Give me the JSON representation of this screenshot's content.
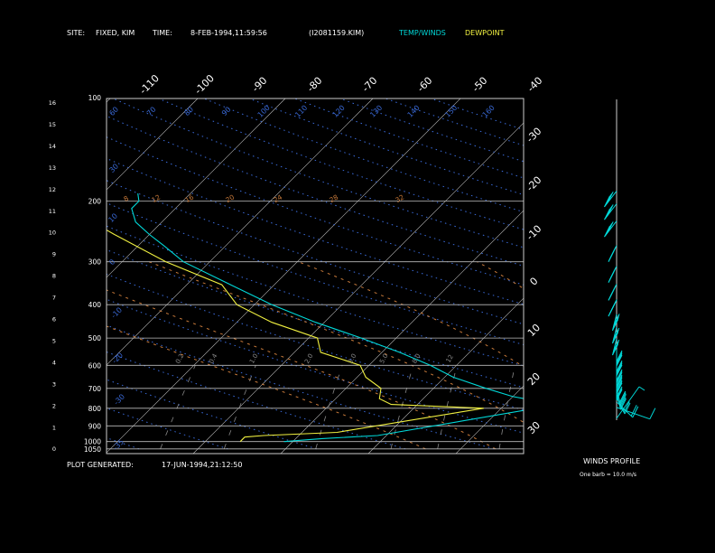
{
  "header": {
    "site_label": "SITE:",
    "site_value": "FIXED, KIM",
    "time_label": "TIME:",
    "time_value": "8-FEB-1994,11:59:56",
    "file_id": "(I2081159.KIM)",
    "legend_temp": "TEMP/WINDS",
    "legend_dew": "DEWPOINT"
  },
  "footer": {
    "generated_label": "PLOT GENERATED:",
    "generated_value": "17-JUN-1994,21:12:50",
    "winds_title": "WINDS PROFILE",
    "barb_note": "One barb = 10.0 m/s"
  },
  "colors": {
    "temp": "#00d8d8",
    "dewpoint": "#f0f040",
    "isobar": "#bbbbbb",
    "isotherm": "#bbbbbb",
    "dry_adiabat": "#3a6ad8",
    "moist_adiabat": "#c87a3a",
    "mixing_ratio": "#888888"
  },
  "chart_data": {
    "type": "skew-t",
    "pressure_labels": [
      "100",
      "200",
      "300",
      "400",
      "500",
      "600",
      "700",
      "800",
      "900",
      "1000",
      "1050"
    ],
    "height_labels": [
      "16",
      "15",
      "14",
      "13",
      "12",
      "11",
      "10",
      "9",
      "8",
      "7",
      "6",
      "5",
      "4",
      "3",
      "2",
      "1",
      "0"
    ],
    "top_isotherm_labels": [
      "-110",
      "-100",
      "-90",
      "-80",
      "-70",
      "-60",
      "-50",
      "-40"
    ],
    "right_isotherm_labels": [
      "-30",
      "-20",
      "-10",
      "0",
      "10",
      "20",
      "30"
    ],
    "dry_adiabat_labels": [
      "10",
      "20",
      "30",
      "40",
      "50",
      "60",
      "70",
      "80",
      "90",
      "100",
      "110",
      "120",
      "130",
      "140",
      "150",
      "160"
    ],
    "theta_e_labels": [
      "8",
      "12",
      "16",
      "20",
      "24",
      "28",
      "32"
    ],
    "mixing_ratio_labels": [
      "0.2",
      "0.4",
      "1.0",
      "2.0",
      "3.0",
      "5.0",
      "8.0",
      "12"
    ],
    "temperature": [
      {
        "p": 1000,
        "t": -21
      },
      {
        "p": 980,
        "t": -17
      },
      {
        "p": 960,
        "t": -11
      },
      {
        "p": 800,
        "t": 4
      },
      {
        "p": 760,
        "t": 3
      },
      {
        "p": 740,
        "t": 0
      },
      {
        "p": 700,
        "t": -4
      },
      {
        "p": 650,
        "t": -9
      },
      {
        "p": 600,
        "t": -13
      },
      {
        "p": 550,
        "t": -18
      },
      {
        "p": 500,
        "t": -24
      },
      {
        "p": 450,
        "t": -31
      },
      {
        "p": 400,
        "t": -38
      },
      {
        "p": 350,
        "t": -45
      },
      {
        "p": 300,
        "t": -53
      },
      {
        "p": 270,
        "t": -57
      },
      {
        "p": 250,
        "t": -60
      },
      {
        "p": 230,
        "t": -63
      },
      {
        "p": 210,
        "t": -65
      },
      {
        "p": 200,
        "t": -65
      },
      {
        "p": 190,
        "t": -66
      }
    ],
    "dewpoint": [
      {
        "p": 1000,
        "t": -26
      },
      {
        "p": 970,
        "t": -26
      },
      {
        "p": 960,
        "t": -24
      },
      {
        "p": 940,
        "t": -16
      },
      {
        "p": 800,
        "t": -2
      },
      {
        "p": 780,
        "t": -13
      },
      {
        "p": 750,
        "t": -15
      },
      {
        "p": 700,
        "t": -16
      },
      {
        "p": 650,
        "t": -19
      },
      {
        "p": 600,
        "t": -21
      },
      {
        "p": 550,
        "t": -27
      },
      {
        "p": 500,
        "t": -29
      },
      {
        "p": 450,
        "t": -36
      },
      {
        "p": 400,
        "t": -42
      },
      {
        "p": 350,
        "t": -46
      },
      {
        "p": 300,
        "t": -55
      },
      {
        "p": 250,
        "t": -64
      },
      {
        "p": 220,
        "t": -70
      },
      {
        "p": 200,
        "t": -73
      },
      {
        "p": 180,
        "t": -75
      }
    ],
    "winds": [
      {
        "p": 1000,
        "speed": 10,
        "dir": 225
      },
      {
        "p": 960,
        "speed": 15,
        "dir": 250
      },
      {
        "p": 930,
        "speed": 20,
        "dir": 260
      },
      {
        "p": 900,
        "speed": 20,
        "dir": 265
      },
      {
        "p": 870,
        "speed": 25,
        "dir": 265
      },
      {
        "p": 840,
        "speed": 30,
        "dir": 270
      },
      {
        "p": 800,
        "speed": 30,
        "dir": 270
      },
      {
        "p": 770,
        "speed": 30,
        "dir": 270
      },
      {
        "p": 740,
        "speed": 30,
        "dir": 270
      },
      {
        "p": 700,
        "speed": 35,
        "dir": 270
      },
      {
        "p": 650,
        "speed": 35,
        "dir": 270
      },
      {
        "p": 600,
        "speed": 40,
        "dir": 275
      },
      {
        "p": 550,
        "speed": 40,
        "dir": 275
      },
      {
        "p": 500,
        "speed": 45,
        "dir": 275
      },
      {
        "p": 450,
        "speed": 45,
        "dir": 280
      },
      {
        "p": 400,
        "speed": 40,
        "dir": 280
      },
      {
        "p": 350,
        "speed": 40,
        "dir": 280
      },
      {
        "p": 300,
        "speed": 35,
        "dir": 280
      },
      {
        "p": 250,
        "speed": 40,
        "dir": 285
      },
      {
        "p": 220,
        "speed": 40,
        "dir": 285
      },
      {
        "p": 200,
        "speed": 35,
        "dir": 285
      }
    ]
  }
}
